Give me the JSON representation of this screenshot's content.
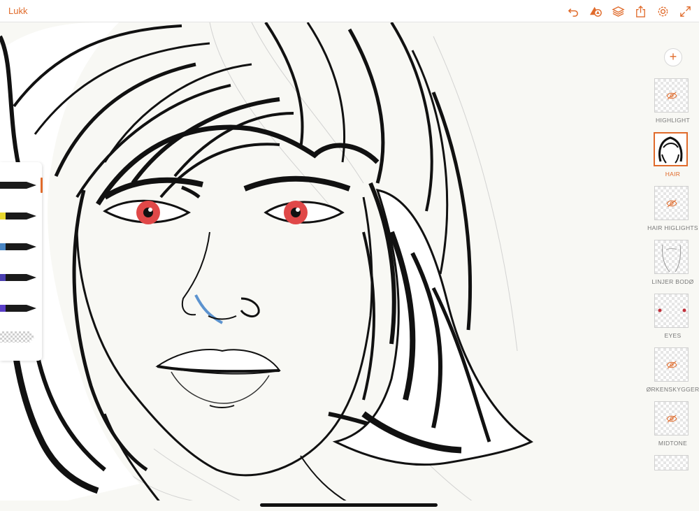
{
  "app": {
    "close_label": "Lukk"
  },
  "toolbar": {
    "icons": [
      "undo-icon",
      "shapes-icon",
      "layers-icon",
      "share-icon",
      "settings-icon",
      "fullscreen-icon"
    ],
    "accent_color": "#e06b2b"
  },
  "layers": {
    "add_icon": "plus-icon",
    "items": [
      {
        "name": "HIGHLIGHT",
        "hidden": true,
        "selected": false
      },
      {
        "name": "HAIR",
        "hidden": false,
        "selected": true
      },
      {
        "name": "HAIR HIGLIGHTS",
        "hidden": true,
        "selected": false
      },
      {
        "name": "LINJER BODØ",
        "hidden": false,
        "selected": false
      },
      {
        "name": "EYES",
        "hidden": false,
        "selected": false
      },
      {
        "name": "ØRKENSKYGGER",
        "hidden": true,
        "selected": false
      },
      {
        "name": "MIDTONE",
        "hidden": true,
        "selected": false
      }
    ]
  },
  "brushes": {
    "colors": [
      "#1a1a1a",
      "#1a1a1a",
      "#4a86c4",
      "#2a3a8c",
      "#3a2f9a"
    ],
    "tip_band_colors": [
      "#1a1a1a",
      "#e8d830",
      "#4a86c4",
      "#4a3fb0",
      "#5b3fc8"
    ],
    "active_index": 0
  },
  "artwork": {
    "eye_color": "#e04848",
    "nose_accent": "#5c93cf"
  }
}
